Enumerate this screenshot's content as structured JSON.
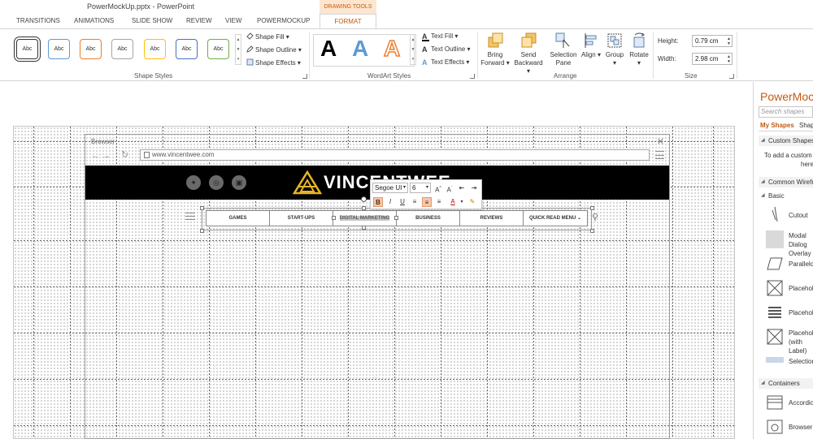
{
  "titlebar": {
    "doc_title": "PowerMockUp.pptx - PowerPoint",
    "contextual_tab": "DRAWING TOOLS"
  },
  "tabs": [
    "TRANSITIONS",
    "ANIMATIONS",
    "SLIDE SHOW",
    "REVIEW",
    "VIEW",
    "POWERMOCKUP"
  ],
  "active_tab": "FORMAT",
  "ribbon": {
    "shape_styles": {
      "label": "Shape Styles",
      "style_sample": "Abc",
      "colors": [
        "#333333",
        "#5b9bd5",
        "#ed7d31",
        "#a5a5a5",
        "#ffc000",
        "#4472c4",
        "#70ad47"
      ]
    },
    "shape_cmds": [
      "Shape Fill",
      "Shape Outline",
      "Shape Effects"
    ],
    "wordart": {
      "label": "WordArt Styles",
      "sample": "A",
      "colors": [
        "#000000",
        "#5b9bd5",
        "#ed7d31"
      ]
    },
    "text_cmds": [
      "Text Fill",
      "Text Outline",
      "Text Effects"
    ],
    "arrange": {
      "label": "Arrange",
      "bring": [
        "Bring",
        "Forward"
      ],
      "send": [
        "Send",
        "Backward"
      ],
      "selection": [
        "Selection",
        "Pane"
      ],
      "align": "Align",
      "group": "Group",
      "rotate": "Rotate"
    },
    "size": {
      "label": "Size",
      "height_label": "Height:",
      "height_value": "0.79 cm",
      "width_label": "Width:",
      "width_value": "2.98 cm"
    }
  },
  "slide": {
    "browser_title": "Browser",
    "url": "www.vincentwee.com",
    "brand": "VINCENTWEE",
    "nav_items": [
      "GAMES",
      "START-UPS",
      "DIGITAL MARKETING",
      "BUSINESS",
      "REVIEWS",
      "QUICK READ MENU"
    ]
  },
  "mini_toolbar": {
    "font": "Segoe UI",
    "size": "6"
  },
  "pane": {
    "title": "PowerMockUp",
    "search_placeholder": "Search shapes",
    "tabs": [
      "My Shapes",
      "Shapes"
    ],
    "custom_header": "Custom Shapes",
    "custom_hint": [
      "To add a custom",
      "here"
    ],
    "common_header": "Common Wireframe",
    "basic_header": "Basic",
    "items": [
      "Cutout",
      "Modal Dialog Overlay",
      "Parallelogram",
      "Placeholder",
      "Placeholder",
      "Placeholder (with Label)",
      "Selection"
    ],
    "containers_header": "Containers",
    "container_items": [
      "Accordion",
      "Browser"
    ]
  }
}
